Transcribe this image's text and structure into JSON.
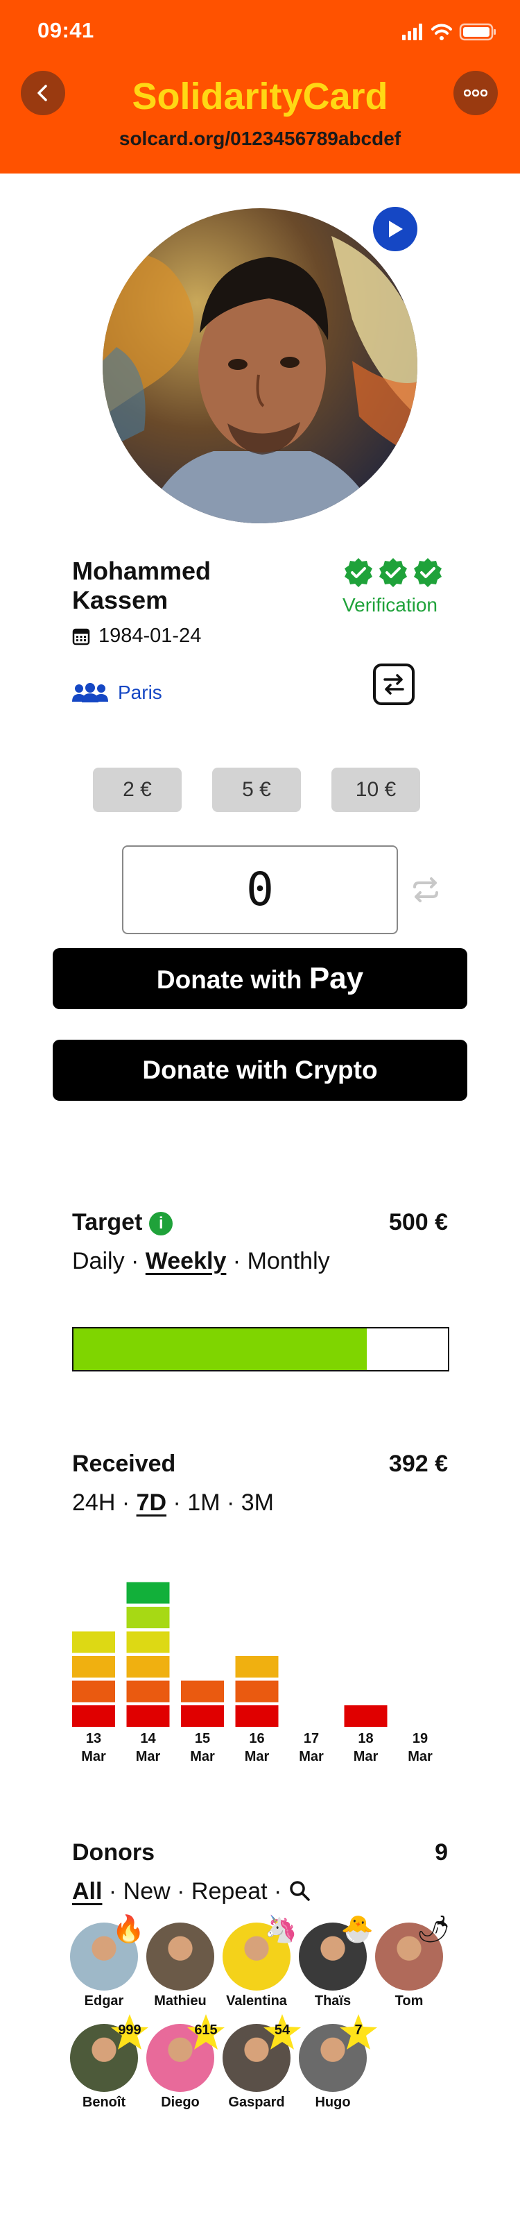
{
  "status": {
    "time": "09:41"
  },
  "header": {
    "title": "SolidarityCard",
    "url": "solcard.org/0123456789abcdef",
    "colors": {
      "background": "#FF5200",
      "title": "#FFD814"
    }
  },
  "profile": {
    "first_name": "Mohammed",
    "last_name": "Kassem",
    "birth_date": "1984-01-24",
    "verification_label": "Verification",
    "verification_checks": 3,
    "city": "Paris"
  },
  "amounts": {
    "chips": [
      "2 €",
      "5 €",
      "10 €"
    ],
    "input_value": "0"
  },
  "buttons": {
    "apple_pay_prefix": "Donate with",
    "apple_pay_glyph": "",
    "apple_pay_word": "Pay",
    "crypto": "Donate with Crypto"
  },
  "target": {
    "title": "Target",
    "value": "500 €",
    "periods": [
      "Daily",
      "Weekly",
      "Monthly"
    ],
    "selected_period": "Weekly",
    "progress_fraction": 0.784
  },
  "received": {
    "title": "Received",
    "value": "392 €",
    "ranges": [
      "24H",
      "7D",
      "1M",
      "3M"
    ],
    "selected_range": "7D"
  },
  "chart_data": {
    "type": "bar",
    "categories": [
      "13 Mar",
      "14 Mar",
      "15 Mar",
      "16 Mar",
      "17 Mar",
      "18 Mar",
      "19 Mar"
    ],
    "day_labels": [
      "13",
      "14",
      "15",
      "16",
      "17",
      "18",
      "19"
    ],
    "month_label": "Mar",
    "values": [
      4,
      6,
      2,
      3,
      0,
      1,
      0
    ],
    "level_colors": [
      "#E00000",
      "#EA5A10",
      "#F0B010",
      "#DDD914",
      "#A7D914",
      "#12B03A"
    ]
  },
  "donors": {
    "title": "Donors",
    "count": "9",
    "filters": [
      "All",
      "New",
      "Repeat"
    ],
    "selected_filter": "All",
    "items": [
      {
        "name": "Edgar",
        "badge": "fire-emoji",
        "glyph": "🔥",
        "color": "#9EB8C8"
      },
      {
        "name": "Mathieu",
        "badge": "hat-emoji",
        "glyph": "",
        "color": "#6B5A48"
      },
      {
        "name": "Valentina",
        "badge": "unicorn-emoji",
        "glyph": "🦄",
        "color": "#F4D21A"
      },
      {
        "name": "Thaïs",
        "badge": "chick-emoji",
        "glyph": "🐣",
        "color": "#3A3A3A"
      },
      {
        "name": "Tom",
        "badge": "pepper-emoji",
        "glyph": "🌶",
        "color": "#B06A5A"
      },
      {
        "name": "Benoît",
        "badge": "star",
        "badge_text": "999",
        "color": "#4D5A3A"
      },
      {
        "name": "Diego",
        "badge": "star",
        "badge_text": "615",
        "color": "#E86A9A"
      },
      {
        "name": "Gaspard",
        "badge": "star",
        "badge_text": "54",
        "color": "#5A5048"
      },
      {
        "name": "Hugo",
        "badge": "star",
        "badge_text": "7",
        "color": "#6A6A6A"
      }
    ]
  }
}
